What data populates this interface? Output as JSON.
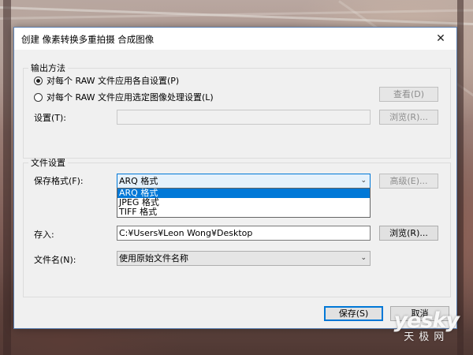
{
  "dialog": {
    "title": "创建 像素转换多重拍摄 合成图像",
    "close_glyph": "✕"
  },
  "output": {
    "legend": "输出方法",
    "option1": "对每个 RAW 文件应用各自设置(P)",
    "option1_selected": true,
    "option2": "对每个 RAW 文件应用选定图像处理设置(L)",
    "option2_selected": false,
    "view_button": "查看(D)",
    "settings_label": "设置(T):",
    "settings_value": "",
    "browse_button": "浏览(R)..."
  },
  "file": {
    "legend": "文件设置",
    "format_label": "保存格式(F):",
    "format_selected": "ARQ 格式",
    "format_options": [
      "ARQ 格式",
      "JPEG 格式",
      "TIFF 格式"
    ],
    "advanced_button": "高级(E)...",
    "save_to_label": "存入:",
    "save_to_value": "C:¥Users¥Leon Wong¥Desktop",
    "browse_button": "浏览(R)...",
    "filename_label": "文件名(N):",
    "filename_value": "使用原始文件名称"
  },
  "footer": {
    "save_button": "保存(S)",
    "cancel_button": "取消"
  },
  "watermark": {
    "line1": "yesky",
    "line2": "天极网"
  }
}
